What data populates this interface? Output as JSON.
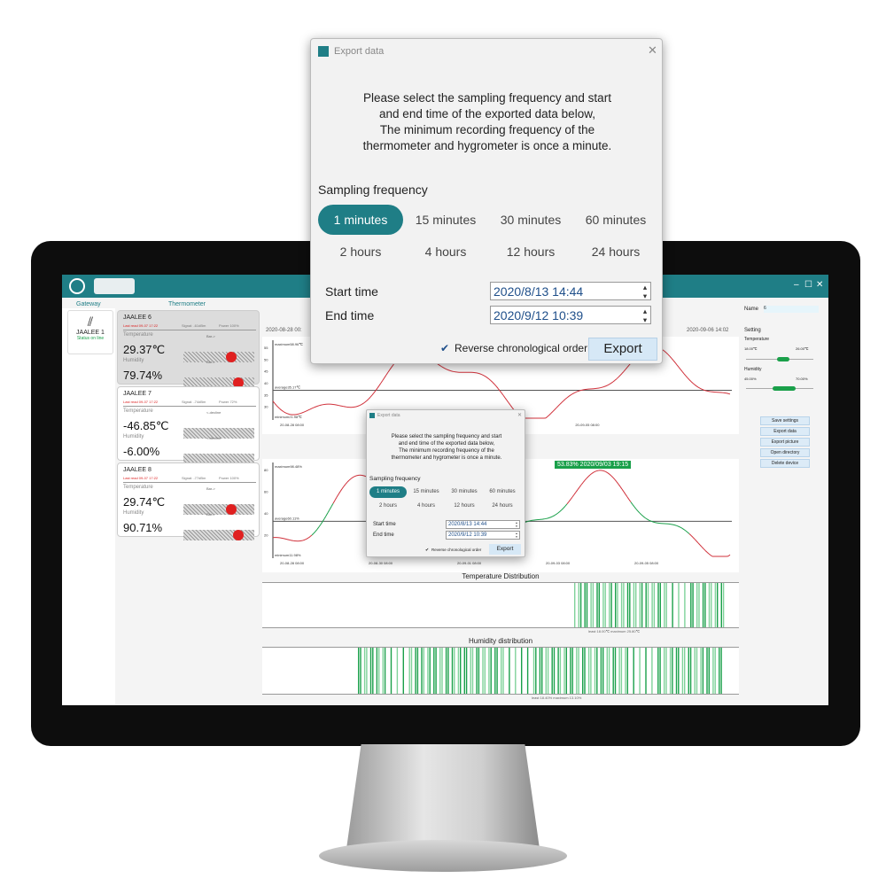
{
  "window": {
    "minimize": "–",
    "maximize": "☐",
    "close": "✕"
  },
  "sidebar": {
    "gateway_header": "Gateway",
    "thermometer_header": "Thermometer",
    "gateway": {
      "name": "JAALEE 1",
      "status": "Status on line"
    }
  },
  "devices": [
    {
      "name": "JAALEE  6",
      "last_read": "Last read 09-07 17:22",
      "signal": "Signal: -61dBm",
      "power": "Power 100%",
      "temp_label": "Temperature",
      "temp": "29.37℃",
      "temp_state": "Bar->",
      "hum_label": "Humidity",
      "hum": "79.74%",
      "hum_state": "Bar->"
    },
    {
      "name": "JAALEE  7",
      "last_read": "Last read 09-07 17:22",
      "signal": "Signal: -74dBm",
      "power": "Power 72%",
      "temp_label": "Temperature",
      "temp": "-46.85℃",
      "temp_state": "<-decline",
      "hum_label": "Humidity",
      "hum": "-6.00%",
      "hum_state": "<-decline"
    },
    {
      "name": "JAALEE  8",
      "last_read": "Last read 09-07 17:22",
      "signal": "Signal: -77dBm",
      "power": "Power 100%",
      "temp_label": "Temperature",
      "temp": "29.74℃",
      "temp_state": "Bar->",
      "hum_label": "Humidity",
      "hum": "90.71%",
      "hum_state": "Bar->"
    }
  ],
  "charts": {
    "range_start": "2020-08-28 00:",
    "range_end": "2020-09-06 14:02",
    "temp": {
      "max": "maximum58.96℃",
      "avg": "average35.17℃",
      "min": "minimum21.98℃",
      "yticks": [
        "55",
        "50",
        "45",
        "40",
        "35",
        "30"
      ],
      "xticks": [
        "20-08-28\n08:00",
        "20-09-03\n08:00",
        "20-09-05\n08:00"
      ]
    },
    "hum": {
      "max": "maximum98.48%",
      "avg": "average60.11%",
      "min": "minimum11.98%",
      "yticks": [
        "80",
        "60",
        "40",
        "20"
      ],
      "xticks": [
        "20-08-28\n08:00",
        "20-08-30\n08:00",
        "20-09-01\n08:00",
        "20-09-03\n08:00",
        "20-09-05\n08:00"
      ],
      "tooltip": "53.83% 2020/09/03 19:15"
    },
    "temp_dist": {
      "title": "Temperature Distribution",
      "legend": "least 18.00℃   maximum 25.80℃"
    },
    "hum_dist": {
      "title": "Humidity distribution",
      "legend": "least 18.40%   maximum 13.10%"
    }
  },
  "settings": {
    "name_label": "Name",
    "name_value": "6",
    "setting": "Setting",
    "temperature": "Temperature",
    "temp_min": "18.00℃",
    "temp_max": "26.00℃",
    "humidity": "Humidity",
    "hum_min": "45.00%",
    "hum_max": "70.00%",
    "buttons": [
      "Save settings",
      "Export data",
      "Export picture",
      "Open directory",
      "Delete device"
    ]
  },
  "export_dialog": {
    "title": "Export data",
    "message": [
      "Please select the sampling frequency and start",
      "and end time of the exported data below,",
      "The minimum recording frequency of the",
      "thermometer and hygrometer is once a minute."
    ],
    "sampling_label": "Sampling frequency",
    "options": [
      "1 minutes",
      "15 minutes",
      "30 minutes",
      "60 minutes",
      "2 hours",
      "4 hours",
      "12 hours",
      "24 hours"
    ],
    "selected": "1 minutes",
    "start_label": "Start time",
    "start_value": "2020/8/13 14:44",
    "end_label": "End time",
    "end_value": "2020/9/12 10:39",
    "reverse_label": "Reverse chronological order",
    "reverse_checked": true,
    "export": "Export",
    "close": "✕"
  },
  "colors": {
    "accent": "#1f7e86",
    "high": "#d0303a",
    "normal": "#1aa04a"
  }
}
